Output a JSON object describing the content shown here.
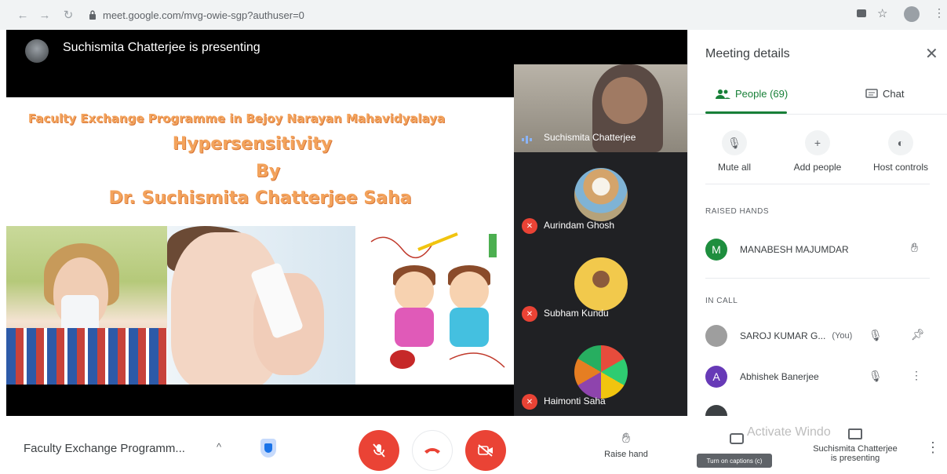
{
  "browser": {
    "url": "meet.google.com/mvg-owie-sgp?authuser=0"
  },
  "presenter": {
    "banner": "Suchismita Chatterjee is presenting"
  },
  "slide": {
    "line1": "Faculty Exchange Programme in Bejoy Narayan Mahavidyalaya",
    "line2": "Hypersensitivity",
    "line3": "By",
    "line4": "Dr. Suchismita Chatterjee Saha"
  },
  "tiles": [
    {
      "name": "Suchismita Chatterjee"
    },
    {
      "name": "Aurindam Ghosh"
    },
    {
      "name": "Subham Kundu"
    },
    {
      "name": "Haimonti Saha"
    }
  ],
  "panel": {
    "title": "Meeting details",
    "tabs": {
      "people": "People (69)",
      "chat": "Chat"
    },
    "actions": [
      {
        "label": "Mute all"
      },
      {
        "label": "Add people"
      },
      {
        "label": "Host controls"
      }
    ],
    "raised_hands_label": "RAISED HANDS",
    "in_call_label": "IN CALL",
    "raised": [
      {
        "initial": "M",
        "name": "MANABESH MAJUMDAR",
        "color": "#1e8e3e"
      }
    ],
    "in_call": [
      {
        "initial": "",
        "name": "SAROJ KUMAR G...",
        "you": "(You)"
      },
      {
        "initial": "A",
        "name": "Abhishek Banerjee",
        "color": "#673ab7"
      }
    ]
  },
  "bottom": {
    "meeting_title": "Faculty Exchange Programm...",
    "raise_hand": "Raise hand",
    "captions": "Turn on captions (c)",
    "presenting_line1": "Suchismita Chatterjee",
    "presenting_line2": "is presenting",
    "activate": "Activate Windo"
  }
}
